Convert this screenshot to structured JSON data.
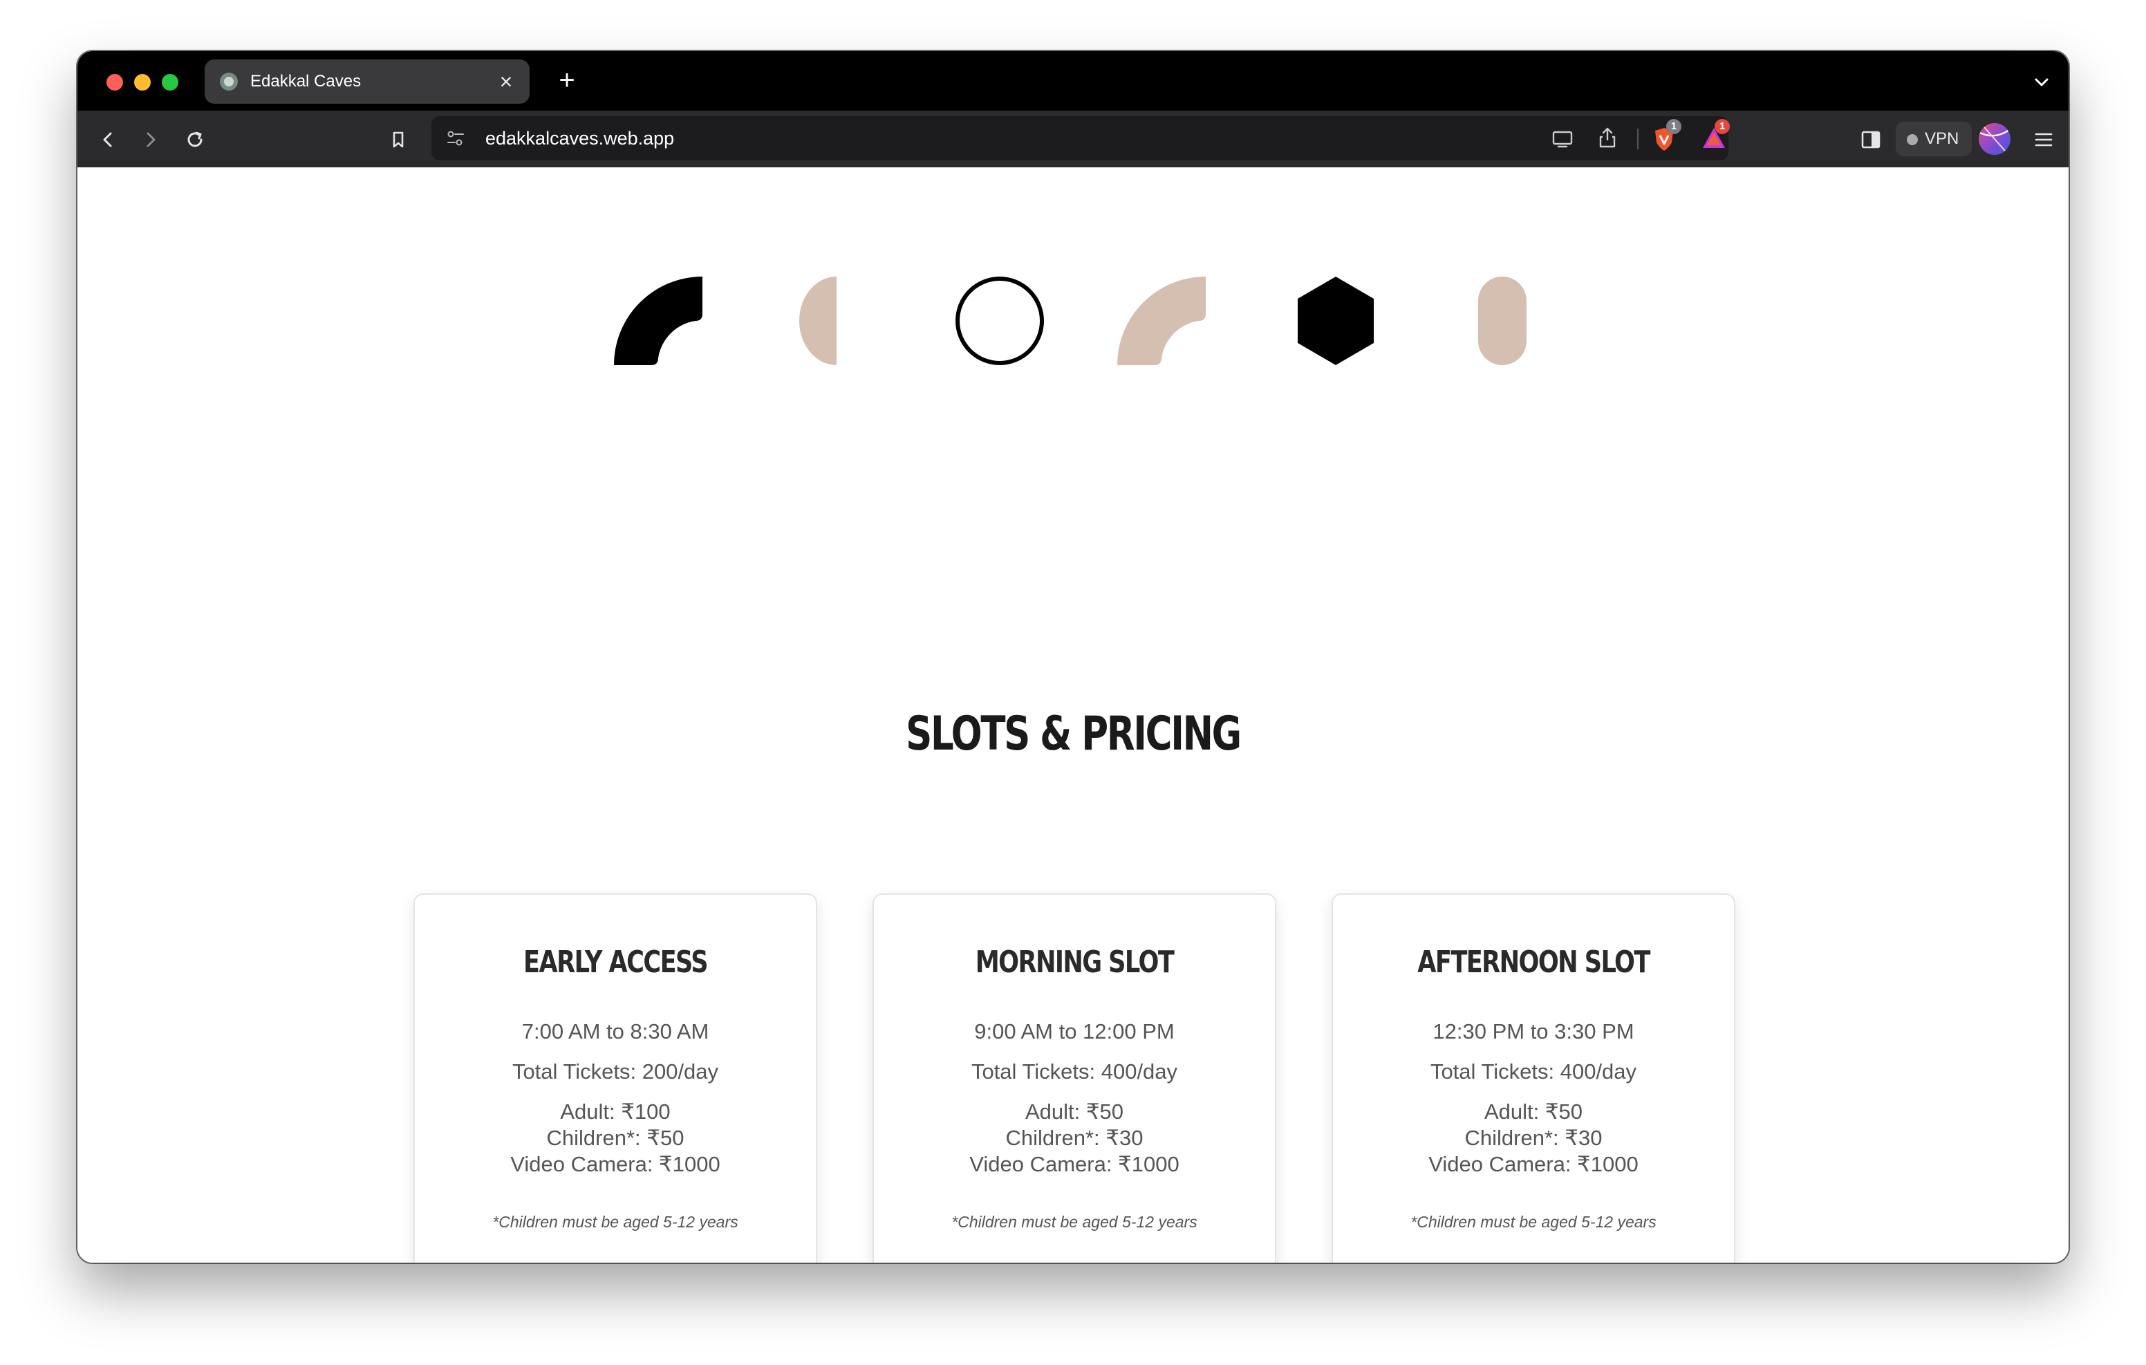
{
  "browser": {
    "tab": {
      "title": "Edakkal Caves"
    },
    "url": "edakkalcaves.web.app",
    "badges": {
      "brave_count": "1",
      "alert_count": "1"
    },
    "vpn_label": "VPN"
  },
  "page": {
    "section_title": "SLOTS & PRICING",
    "slots": [
      {
        "title": "EARLY ACCESS",
        "time": "7:00 AM to 8:30 AM",
        "tickets": "Total Tickets: 200/day",
        "adult": "Adult: ₹100",
        "children": "Children*: ₹50",
        "camera": "Video Camera: ₹1000",
        "note": "*Children must be aged 5-12 years"
      },
      {
        "title": "MORNING SLOT",
        "time": "9:00 AM to 12:00 PM",
        "tickets": "Total Tickets: 400/day",
        "adult": "Adult: ₹50",
        "children": "Children*: ₹30",
        "camera": "Video Camera: ₹1000",
        "note": "*Children must be aged 5-12 years"
      },
      {
        "title": "AFTERNOON SLOT",
        "time": "12:30 PM to 3:30 PM",
        "tickets": "Total Tickets: 400/day",
        "adult": "Adult: ₹50",
        "children": "Children*: ₹30",
        "camera": "Video Camera: ₹1000",
        "note": "*Children must be aged 5-12 years"
      }
    ]
  },
  "colors": {
    "shape_dark": "#000000",
    "shape_beige": "#d4bfb1",
    "brave_orange": "#f0562c",
    "alert_red": "#e8453c"
  }
}
